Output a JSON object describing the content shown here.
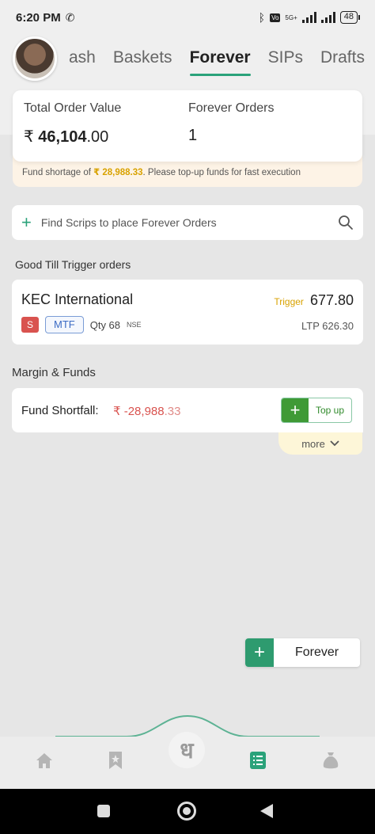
{
  "status_bar": {
    "time": "6:20 PM",
    "battery": "48",
    "network": "5G+"
  },
  "tabs": [
    {
      "label": "ash",
      "active": false
    },
    {
      "label": "Baskets",
      "active": false
    },
    {
      "label": "Forever",
      "active": true
    },
    {
      "label": "SIPs",
      "active": false
    },
    {
      "label": "Drafts",
      "active": false
    }
  ],
  "summary": {
    "total_order_value_label": "Total Order Value",
    "currency_symbol": "₹",
    "total_order_value_main": "46,104",
    "total_order_value_decimal": ".00",
    "forever_orders_label": "Forever Orders",
    "forever_orders_value": "1"
  },
  "shortage": {
    "prefix": "Fund shortage of ",
    "amount": "₹ 28,988.33",
    "suffix": ". Please top-up funds for fast execution"
  },
  "search": {
    "placeholder": "Find Scrips to place Forever Orders"
  },
  "gtt_section_title": "Good Till Trigger orders",
  "order": {
    "name": "KEC International",
    "trigger_label": "Trigger",
    "trigger_value": "677.80",
    "side": "S",
    "product": "MTF",
    "qty": "Qty 68",
    "exchange": "NSE",
    "ltp": "LTP 626.30"
  },
  "margin_section_title": "Margin & Funds",
  "margin": {
    "fund_shortfall_label": "Fund Shortfall:",
    "currency_symbol": "₹",
    "fund_shortfall_main": "-28,988",
    "fund_shortfall_decimal": ".33",
    "topup_label": "Top up",
    "more_label": "more"
  },
  "fab": {
    "label": "Forever"
  },
  "bottom_nav": {
    "items": [
      "home-icon",
      "watchlist-icon",
      "orders-icon",
      "funds-icon"
    ],
    "center_logo_char": "ध",
    "active_item": "orders-icon"
  },
  "colors": {
    "accent_green": "#2aa27a",
    "loss_red": "#d9534f",
    "warning_yellow": "#d8a200"
  }
}
